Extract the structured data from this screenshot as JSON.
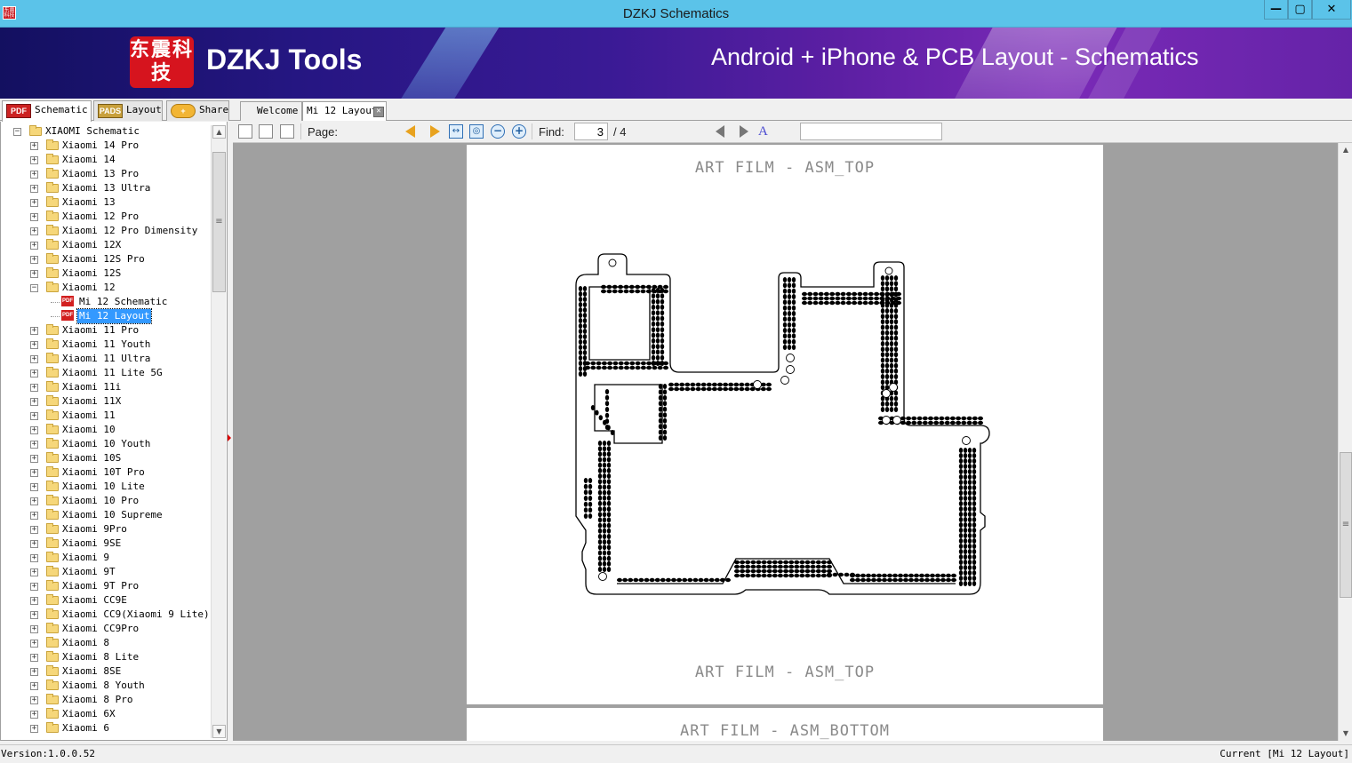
{
  "window": {
    "title": "DZKJ Schematics",
    "minimize_label": "—",
    "maximize_label": "▢",
    "close_label": "✕",
    "app_icon_text": "东震科技"
  },
  "banner": {
    "logo_text": "东震科技",
    "brand": "DZKJ Tools",
    "tagline": "Android + iPhone & PCB Layout - Schematics"
  },
  "left_tabs": [
    {
      "label": "Schematic",
      "icon": "pdf-icon",
      "icon_text": "PDF"
    },
    {
      "label": "Layout",
      "icon": "pads-icon",
      "icon_text": "PADS"
    },
    {
      "label": "Share",
      "icon": "share-icon",
      "icon_text": "+"
    }
  ],
  "tree": {
    "root": "XIAOMI Schematic",
    "items": [
      {
        "label": "Xiaomi 14 Pro"
      },
      {
        "label": "Xiaomi 14"
      },
      {
        "label": "Xiaomi 13 Pro"
      },
      {
        "label": "Xiaomi 13 Ultra"
      },
      {
        "label": "Xiaomi 13"
      },
      {
        "label": "Xiaomi 12 Pro"
      },
      {
        "label": "Xiaomi 12 Pro Dimensity"
      },
      {
        "label": "Xiaomi 12X"
      },
      {
        "label": "Xiaomi 12S Pro"
      },
      {
        "label": "Xiaomi 12S"
      },
      {
        "label": "Xiaomi 12",
        "expanded": true,
        "children": [
          {
            "label": "Mi 12 Schematic"
          },
          {
            "label": "Mi 12 Layout",
            "selected": true
          }
        ]
      },
      {
        "label": "Xiaomi 11 Pro"
      },
      {
        "label": "Xiaomi 11 Youth"
      },
      {
        "label": "Xiaomi 11 Ultra"
      },
      {
        "label": "Xiaomi 11 Lite 5G"
      },
      {
        "label": "Xiaomi 11i"
      },
      {
        "label": "Xiaomi 11X"
      },
      {
        "label": "Xiaomi 11"
      },
      {
        "label": "Xiaomi 10"
      },
      {
        "label": "Xiaomi 10 Youth"
      },
      {
        "label": "Xiaomi 10S"
      },
      {
        "label": "Xiaomi 10T Pro"
      },
      {
        "label": "Xiaomi 10 Lite"
      },
      {
        "label": "Xiaomi 10 Pro"
      },
      {
        "label": "Xiaomi 10 Supreme"
      },
      {
        "label": "Xiaomi 9Pro"
      },
      {
        "label": "Xiaomi 9SE"
      },
      {
        "label": "Xiaomi 9"
      },
      {
        "label": "Xiaomi 9T"
      },
      {
        "label": "Xiaomi 9T Pro"
      },
      {
        "label": "Xiaomi CC9E"
      },
      {
        "label": "Xiaomi CC9(Xiaomi 9 Lite)"
      },
      {
        "label": "Xiaomi CC9Pro"
      },
      {
        "label": "Xiaomi 8"
      },
      {
        "label": "Xiaomi 8 Lite"
      },
      {
        "label": "Xiaomi 8SE"
      },
      {
        "label": "Xiaomi 8 Youth"
      },
      {
        "label": "Xiaomi 8 Pro"
      },
      {
        "label": "Xiaomi 6X"
      },
      {
        "label": "Xiaomi 6"
      }
    ]
  },
  "doc_tabs": [
    {
      "label": "Welcome"
    },
    {
      "label": "Mi 12 Layout",
      "active": true,
      "close_label": "✕"
    }
  ],
  "toolbar": {
    "page_label": "Page:",
    "page_current": "3",
    "page_total": "/ 4",
    "find_label": "Find:",
    "find_value": ""
  },
  "viewer": {
    "page3_caption_top": "ART FILM - ASM_TOP",
    "page3_caption_bottom": "ART FILM - ASM_TOP",
    "page4_caption_top": "ART FILM - ASM_BOTTOM"
  },
  "status": {
    "version": "Version:1.0.0.52",
    "current": "Current [Mi 12 Layout]"
  }
}
